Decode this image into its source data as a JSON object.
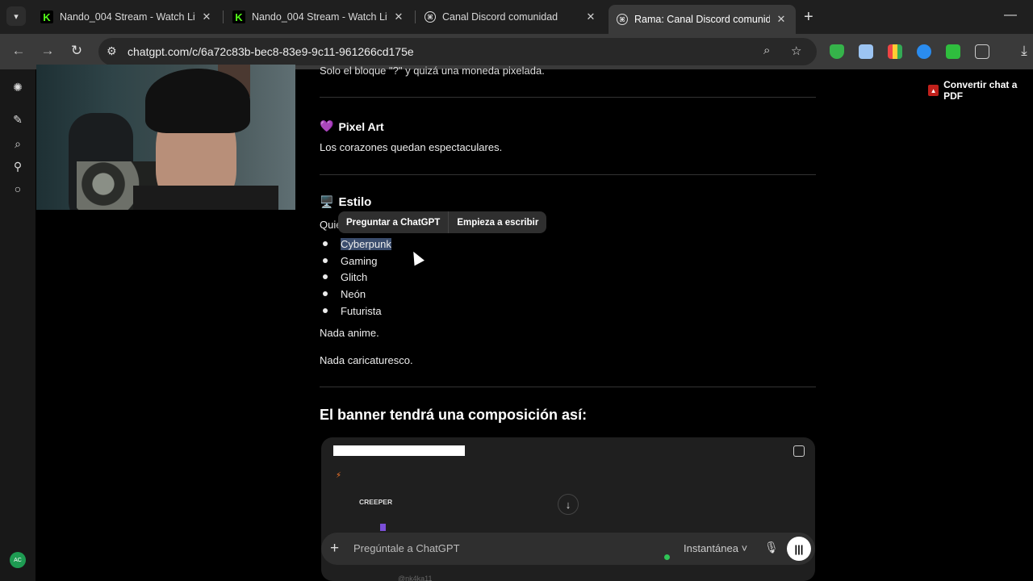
{
  "browser": {
    "tabs": [
      {
        "title": "Nando_004 Stream - Watch Live",
        "favicon": "kick-icon"
      },
      {
        "title": "Nando_004 Stream - Watch Live",
        "favicon": "kick-icon"
      },
      {
        "title": "Canal Discord comunidad",
        "favicon": "chatgpt-icon"
      },
      {
        "title": "Rama: Canal Discord comunidad",
        "favicon": "chatgpt-icon",
        "active": true
      }
    ],
    "url": "chatgpt.com/c/6a72c83b-bec8-83e9-9c11-961266cd175e"
  },
  "extensions": {
    "pdf_button": "Convertir chat a PDF"
  },
  "content": {
    "cut_line": "Solo el bloque \"?\" y quizá una moneda pixelada.",
    "section_pixel": {
      "emoji": "💜",
      "title": "Pixel Art",
      "text": "Los corazones quedan espectaculares."
    },
    "section_estilo": {
      "emoji": "🖥️",
      "title": "Estilo",
      "intro": "Quiero"
    },
    "style_items": [
      "Cyberpunk",
      "Gaming",
      "Glitch",
      "Neón",
      "Futurista"
    ],
    "after1": "Nada anime.",
    "after2": "Nada caricaturesco.",
    "heading": "El banner tendrá una composición así:"
  },
  "selection_popup": {
    "ask": "Preguntar a ChatGPT",
    "write": "Empieza a escribir"
  },
  "code_block": {
    "label": "CREEPER",
    "faint": "@nk4ka11"
  },
  "composer": {
    "placeholder": "Pregúntale a ChatGPT",
    "model": "Instantánea"
  },
  "sidebar": {
    "avatar_initials": "AC"
  },
  "colors": {
    "accent_green": "#2fc456",
    "kick_green": "#53fc18",
    "selection": "#3b4d6e"
  }
}
